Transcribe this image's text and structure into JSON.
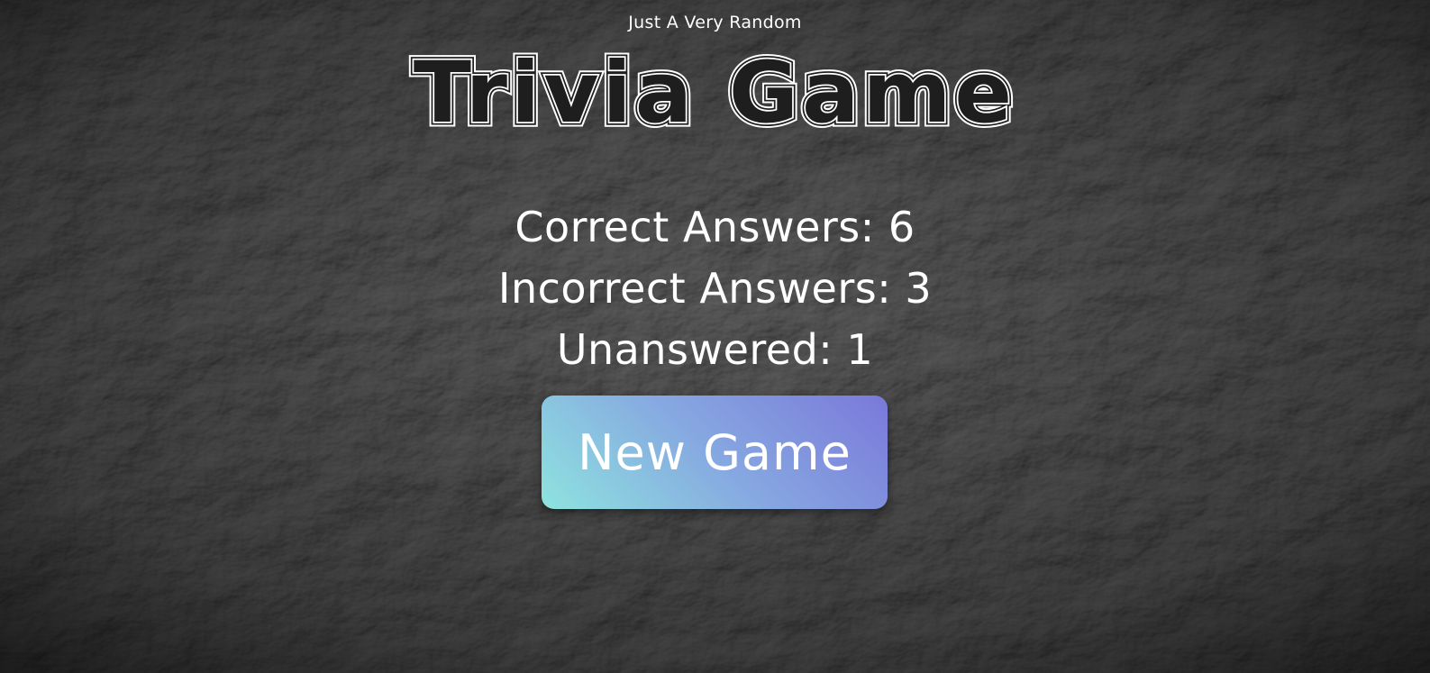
{
  "header": {
    "subtitle": "Just A Very Random",
    "title": "Trivia Game"
  },
  "results": {
    "correct_label": "Correct Answers: 6",
    "incorrect_label": "Incorrect Answers: 3",
    "unanswered_label": "Unanswered: 1"
  },
  "actions": {
    "new_game_label": "New Game"
  },
  "colors": {
    "button_gradient_start": "#8ee3df",
    "button_gradient_end": "#7a79d9",
    "text": "#ffffff",
    "background_rock": "#3b3b3b"
  }
}
